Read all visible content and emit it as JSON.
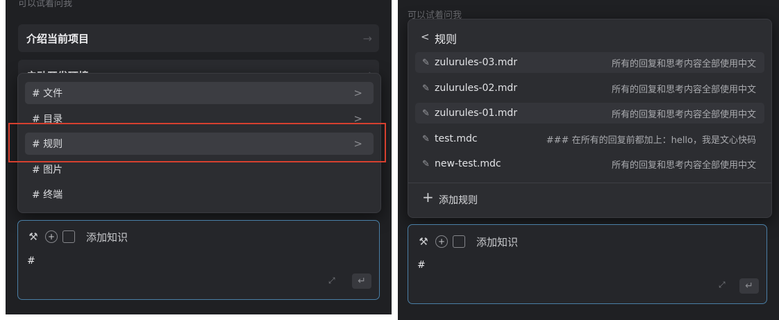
{
  "left": {
    "hint": "可以试着问我",
    "suggestions": [
      {
        "label": "介绍当前项目",
        "arrow": "→"
      },
      {
        "label": "启动开发环境",
        "arrow": "→"
      }
    ],
    "menu_items": [
      {
        "label": "# 文件",
        "chevron": ">"
      },
      {
        "label": "# 目录",
        "chevron": ">"
      },
      {
        "label": "# 规则",
        "chevron": ">"
      },
      {
        "label": "# 图片",
        "chevron": ""
      },
      {
        "label": "# 终端",
        "chevron": ""
      }
    ],
    "input": {
      "kb_label": "添加知识",
      "value": "#",
      "expand_icon": "⤢",
      "send_icon": "↵"
    }
  },
  "right": {
    "hint": "可以试着问我",
    "submenu": {
      "back_icon": "<",
      "title": "规则",
      "rules": [
        {
          "file": "zulurules-03.mdr",
          "desc": "所有的回复和思考内容全部使用中文"
        },
        {
          "file": "zulurules-02.mdr",
          "desc": "所有的回复和思考内容全部使用中文"
        },
        {
          "file": "zulurules-01.mdr",
          "desc": "所有的回复和思考内容全部使用中文"
        },
        {
          "file": "test.mdc",
          "desc": "### 在所有的回复前都加上：hello，我是文心快码"
        },
        {
          "file": "new-test.mdc",
          "desc": "所有的回复和思考内容全部使用中文"
        }
      ],
      "add_icon": "+",
      "add_label": "添加规则"
    },
    "input": {
      "kb_label": "添加知识",
      "value": "#",
      "expand_icon": "⤢",
      "send_icon": "↵"
    }
  },
  "icons": {
    "pencil": "✎",
    "hammer": "⚒",
    "plus_circle": "⊕",
    "image": "▣"
  },
  "colors": {
    "background": "#1f2023",
    "highlight_box": "#d6402f",
    "input_border": "#4a7fa6"
  }
}
